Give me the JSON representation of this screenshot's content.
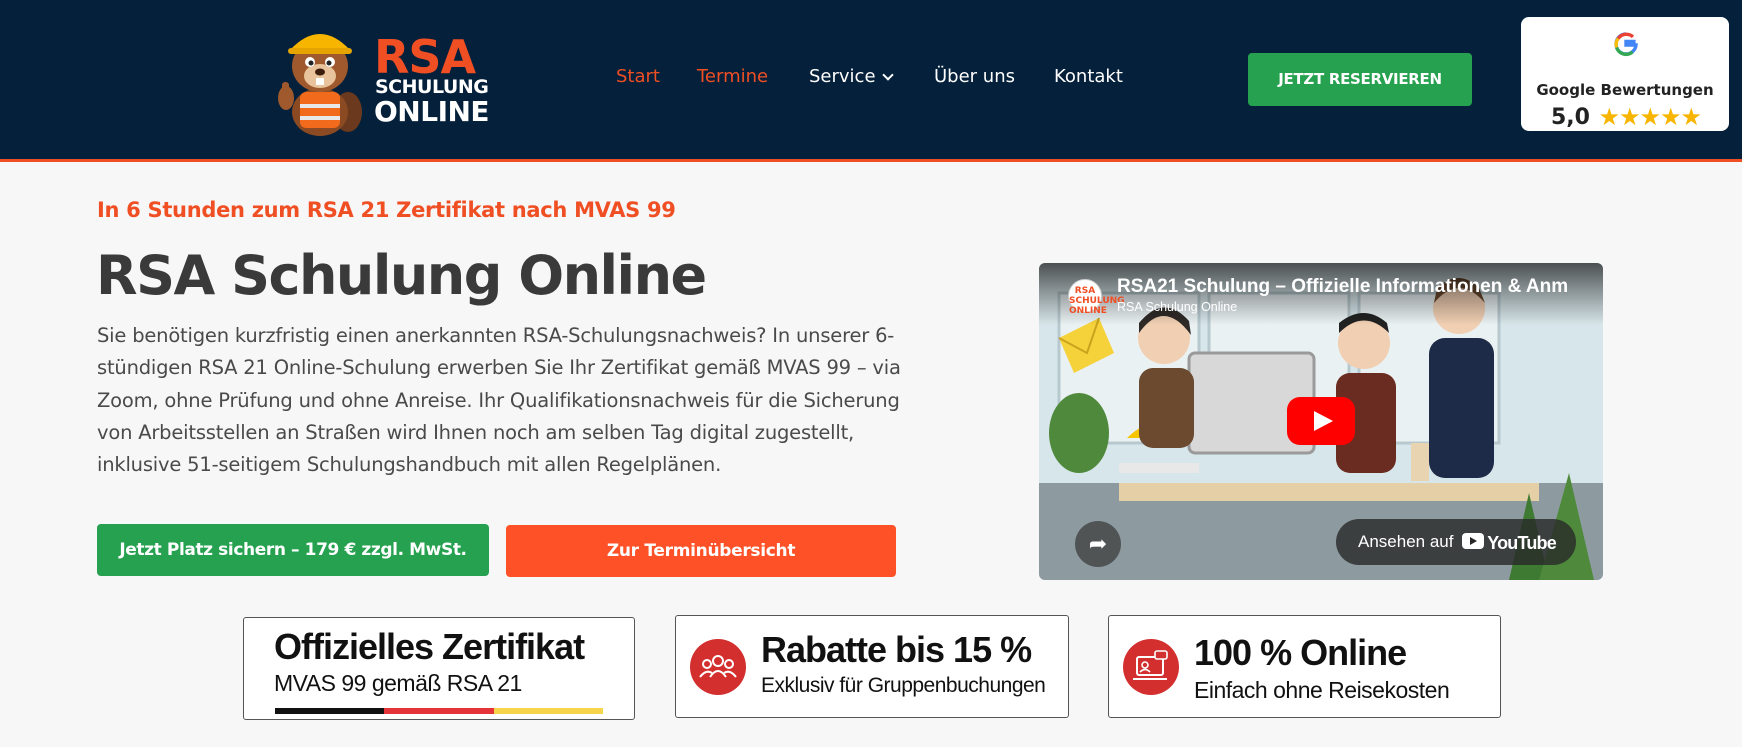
{
  "header": {
    "logo": {
      "line1": "RSA",
      "line2": "SCHULUNG",
      "line3": "ONLINE"
    },
    "nav": [
      {
        "label": "Start",
        "active": true
      },
      {
        "label": "Termine",
        "active": true
      },
      {
        "label": "Service",
        "has_dropdown": true
      },
      {
        "label": "Über uns"
      },
      {
        "label": "Kontakt"
      }
    ],
    "reserve_button": "JETZT RESERVIEREN",
    "google": {
      "title": "Google Bewertungen",
      "rating": "5,0",
      "stars": "★★★★★",
      "rating_value": 5
    }
  },
  "hero": {
    "eyebrow": "In 6 Stunden zum RSA 21 Zertifikat nach MVAS 99",
    "title": "RSA Schulung Online",
    "text": "Sie benötigen kurzfristig einen anerkannten RSA-Schulungsnachweis? In unserer 6-stündigen RSA 21 Online-Schulung erwerben Sie Ihr Zertifikat gemäß MVAS 99 – via Zoom, ohne Prüfung und ohne Anreise. Ihr Qualifikationsnachweis für die Sicherung von Arbeitsstellen an Straßen wird Ihnen noch am selben Tag digital zugestellt, inklusive 51-seitigem Schulungshandbuch mit allen Regelplänen.",
    "primary_button": "Jetzt Platz sichern – 179 € zzgl. MwSt.",
    "secondary_button": "Zur Terminübersicht"
  },
  "video": {
    "title": "RSA21 Schulung – Offizielle Informationen & Anm",
    "channel": "RSA Schulung Online",
    "avatar_text": "RSA SCHULUNG ONLINE",
    "watch_label": "Ansehen auf",
    "youtube_label": "YouTube"
  },
  "features": [
    {
      "title": "Offizielles Zertifikat",
      "subtitle": "MVAS 99 gemäß RSA 21"
    },
    {
      "title": "Rabatte bis 15 %",
      "subtitle": "Exklusiv für Gruppenbuchungen",
      "icon": "group-icon"
    },
    {
      "title": "100 % Online",
      "subtitle": "Einfach ohne Reisekosten",
      "icon": "online-computer-icon"
    }
  ],
  "colors": {
    "header_bg": "#04203a",
    "accent_orange": "#f04e23",
    "button_green": "#25a14f",
    "button_orange": "#fe5128",
    "star": "#f7b500",
    "icon_red": "#d32f2f"
  }
}
